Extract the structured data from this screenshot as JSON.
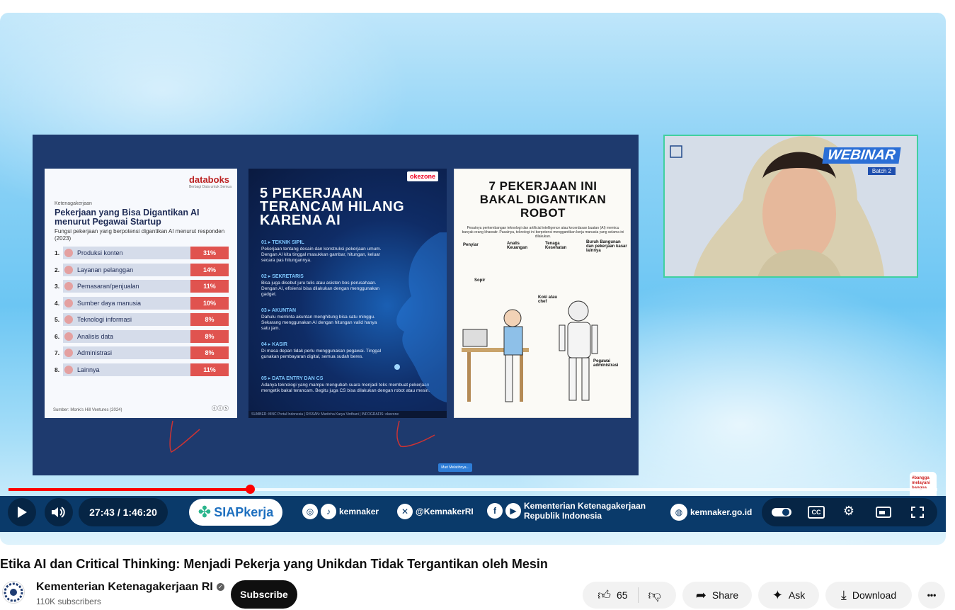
{
  "player": {
    "slide": {
      "databoks": {
        "logo": "databoks",
        "logo_tagline": "Berbagi Data untuk Semua",
        "category": "Ketenagakerjaan",
        "title": "Pekerjaan yang Bisa Digantikan AI menurut Pegawai Startup",
        "subtitle": "Fungsi pekerjaan yang berpotensi digantikan AI menurut responden (2023)",
        "rows": [
          {
            "n": "1.",
            "label": "Produksi konten",
            "pct": "31%"
          },
          {
            "n": "2.",
            "label": "Layanan pelanggan",
            "pct": "14%"
          },
          {
            "n": "3.",
            "label": "Pemasaran/penjualan",
            "pct": "11%"
          },
          {
            "n": "4.",
            "label": "Sumber daya manusia",
            "pct": "10%"
          },
          {
            "n": "5.",
            "label": "Teknologi informasi",
            "pct": "8%"
          },
          {
            "n": "6.",
            "label": "Analisis data",
            "pct": "8%"
          },
          {
            "n": "7.",
            "label": "Administrasi",
            "pct": "8%"
          },
          {
            "n": "8.",
            "label": "Lainnya",
            "pct": "11%"
          }
        ],
        "source": "Sumber: Monk's Hill Ventures (2024)",
        "license": "ⓒⓘⓢ"
      },
      "okezone": {
        "logo": "okezone",
        "title": "5 PEKERJAAN TERANCAM HILANG KARENA AI",
        "items": [
          {
            "head": "01 ▸ TEKNIK SIPIL",
            "text": "Pekerjaan tentang desain dan konstruksi pekerjaan umum. Dengan AI kita tinggal masukkan gambar, hitungan, keluar secara pas hitungannya."
          },
          {
            "head": "02 ▸ SEKRETARIS",
            "text": "Bisa juga disebut juru tulis atau asisten bos perusahaan. Dengan AI, efisiensi bisa dilakukan dengan menggunakan gadget."
          },
          {
            "head": "03 ▸ AKUNTAN",
            "text": "Dahulu meminta akuntan menghitung bisa satu minggu. Sekarang menggunakan AI dengan hitungan valid hanya satu jam."
          },
          {
            "head": "04 ▸ KASIR",
            "text": "Di masa depan tidak perlu menggunakan pegawai. Tinggal gunakan pembayaran digital, semua sudah beres."
          },
          {
            "head": "05 ▸ DATA ENTRY DAN CS",
            "text": "Adanya teknologi yang mampu mengubah suara menjadi teks membuat pekerjaan mengetik bakal terancam. Begitu juga CS bisa dilakukan dengan robot atau mesin."
          }
        ],
        "footer": "SUMBER: MNC Portal Indonesia | RISSAN: Maritcha Karya Virdhani | INFOGRAFIS: okezone"
      },
      "cnbc": {
        "title": "7 PEKERJAAN INI BAKAL DIGANTIKAN ROBOT",
        "intro": "Pesatnya perkembangan teknologi dan artificial intelligence atau kecerdasan buatan (AI) memicu banyak orang khawatir. Pasalnya, teknologi ini berpotensi menggantikan kerja manusia yang selama ini dilakukan.",
        "labels": [
          "Penyiar",
          "Analis Keuangan",
          "Tenaga Kesehatan",
          "Buruh Bangunan dan pekerjaan kasar lainnya",
          "Sopir",
          "Koki atau chef",
          "Pegawai administrasi"
        ]
      },
      "button_label": "Mari Melatihnya..."
    },
    "webcam": {
      "webinar": "WEBINAR",
      "batch": "Batch 2"
    },
    "corner_badge": "#bangga melayani bangsa",
    "progress": {
      "played_fraction": 0.26
    },
    "controls": {
      "time": "27:43 / 1:46:20",
      "siapkerja": "SIAPkerja",
      "tiktok_handle": "kemnaker",
      "x_handle": "@KemnakerRI",
      "org_name": "Kementerian Ketenagakerjaan Republik Indonesia",
      "website": "kemnaker.go.id",
      "cc_label": "CC"
    }
  },
  "video": {
    "title": "Etika AI dan Critical Thinking: Menjadi Pekerja yang Unikdan Tidak Tergantikan oleh Mesin",
    "channel": "Kementerian Ketenagakerjaan RI",
    "subscribers": "110K subscribers",
    "subscribe_label": "Subscribe",
    "likes": "65",
    "share_label": "Share",
    "ask_label": "Ask",
    "download_label": "Download",
    "more_label": "•••"
  }
}
